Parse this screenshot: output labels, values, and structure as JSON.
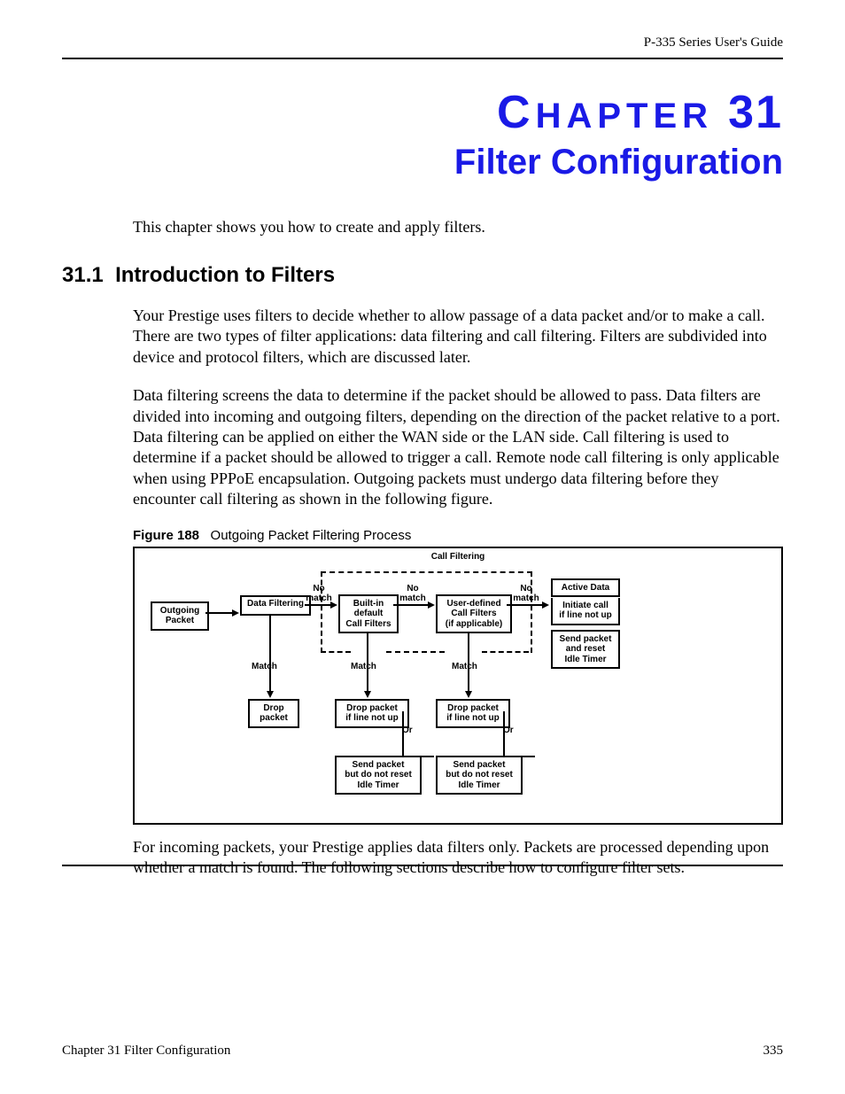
{
  "header": {
    "running_head": "P-335 Series User's Guide"
  },
  "chapter": {
    "label_prefix": "C",
    "label_rest": "HAPTER",
    "number": "31",
    "title": "Filter Configuration"
  },
  "intro_text": "This chapter shows you how to create and apply filters.",
  "section": {
    "number": "31.1",
    "title": "Introduction to Filters"
  },
  "paragraphs": {
    "p1": "Your Prestige uses filters to decide whether to allow passage of a data packet and/or to make a call. There are two types of filter applications: data filtering and call filtering. Filters are subdivided into device and protocol filters, which are discussed later.",
    "p2": "Data filtering screens the data to determine if the packet should be allowed to pass. Data filters are divided into incoming and outgoing filters, depending on the direction of the packet relative to a port. Data filtering can be applied on either the WAN side or the LAN side. Call filtering is used to determine if a packet should be allowed to trigger a call. Remote node call filtering is only applicable when using PPPoE encapsulation. Outgoing packets must undergo data filtering before they encounter call filtering as shown in the following figure.",
    "p3": "For incoming packets, your Prestige applies data filters only. Packets are processed depending upon whether a match is found. The following sections describe how to configure filter sets."
  },
  "figure": {
    "label": "Figure 188",
    "caption": "Outgoing Packet Filtering Process",
    "diagram": {
      "group_label": "Call Filtering",
      "boxes": {
        "outgoing_packet": "Outgoing\nPacket",
        "data_filtering": "Data Filtering",
        "builtin": "Built-in\ndefault\nCall Filters",
        "userdef": "User-defined\nCall Filters\n(if applicable)",
        "active": "Active Data",
        "initiate": "Initiate call\nif line not up",
        "send_reset": "Send packet\nand reset\nIdle Timer",
        "drop_packet": "Drop\npacket",
        "drop_not_up1": "Drop packet\nif line not up",
        "drop_not_up2": "Drop packet\nif line not up",
        "send_noreset1": "Send packet\nbut do not reset\nIdle Timer",
        "send_noreset2": "Send packet\nbut do not reset\nIdle Timer"
      },
      "labels": {
        "no_match": "No\nmatch",
        "match": "Match",
        "or": "Or"
      }
    }
  },
  "footer": {
    "left": "Chapter 31 Filter Configuration",
    "page": "335"
  }
}
